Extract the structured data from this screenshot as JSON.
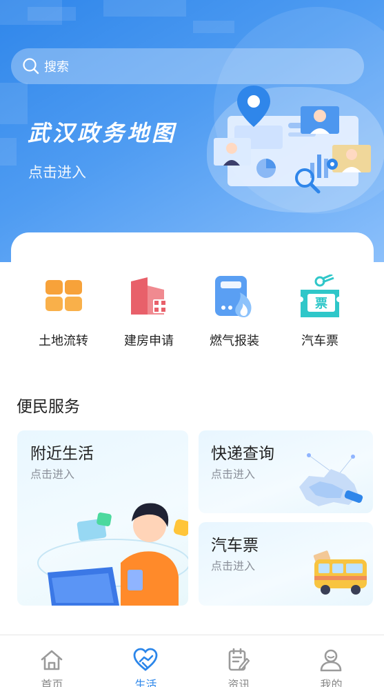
{
  "search": {
    "placeholder": "搜索"
  },
  "banner": {
    "title": "武汉政务地图",
    "subtitle": "点击进入"
  },
  "quick_services": [
    {
      "label": "土地流转",
      "icon": "land-transfer-icon"
    },
    {
      "label": "建房申请",
      "icon": "building-application-icon"
    },
    {
      "label": "燃气报装",
      "icon": "gas-installation-icon"
    },
    {
      "label": "汽车票",
      "icon": "bus-ticket-icon"
    }
  ],
  "quick_ticket_glyph": "票",
  "convenience": {
    "title": "便民服务",
    "cards": [
      {
        "title": "附近生活",
        "subtitle": "点击进入"
      },
      {
        "title": "快递查询",
        "subtitle": "点击进入"
      },
      {
        "title": "汽车票",
        "subtitle": "点击进入"
      }
    ]
  },
  "tabbar": {
    "items": [
      {
        "label": "首页",
        "icon": "home-icon"
      },
      {
        "label": "生活",
        "icon": "life-heart-icon"
      },
      {
        "label": "资讯",
        "icon": "news-icon"
      },
      {
        "label": "我的",
        "icon": "profile-icon"
      }
    ],
    "active": "生活"
  },
  "colors": {
    "banner": "#3d8fee",
    "accent": "#2b86ea",
    "tab_inactive": "#888888",
    "orange": "#f7a23a",
    "red": "#e8606a",
    "teal": "#2fc7c9"
  }
}
